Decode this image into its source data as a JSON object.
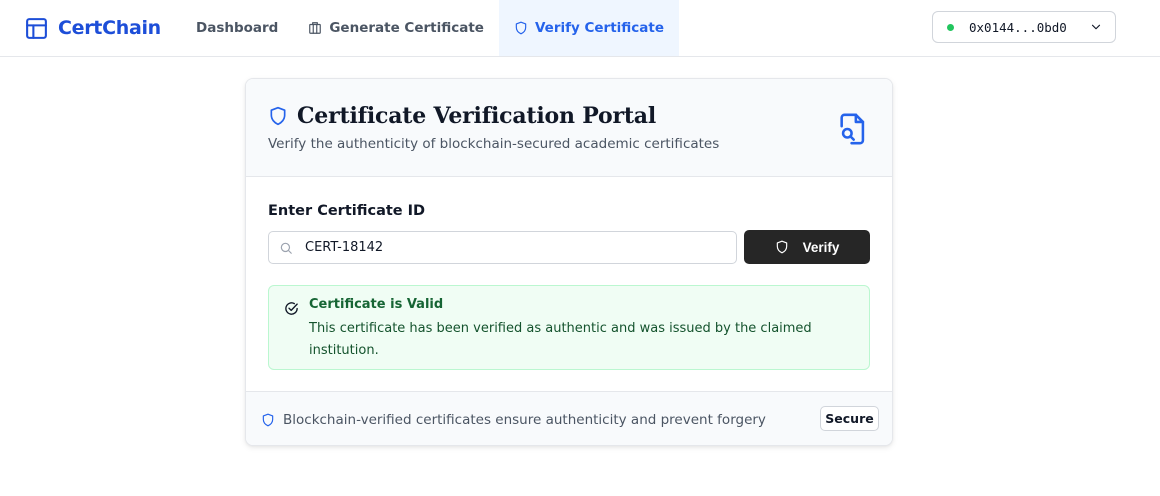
{
  "app": {
    "name": "CertChain",
    "brand_color": "#1d4ed8",
    "logo_icon": "layout-icon"
  },
  "nav": {
    "items": [
      {
        "label": "Dashboard",
        "icon": null,
        "active": false
      },
      {
        "label": "Generate Certificate",
        "icon": "building-icon",
        "active": false
      },
      {
        "label": "Verify Certificate",
        "icon": "shield-icon",
        "active": true
      }
    ],
    "active_color": "#2563eb"
  },
  "wallet": {
    "address": "0x0144...0bd0",
    "status": "connected",
    "status_color": "#22c55e"
  },
  "card": {
    "title": "Certificate Verification Portal",
    "subtitle": "Verify the authenticity of blockchain-secured academic certificates",
    "header_icon": "file-search-icon",
    "field_label": "Enter Certificate ID",
    "input_value": "CERT-18142",
    "verify_label": "Verify",
    "result": {
      "status": "valid",
      "title": "Certificate is Valid",
      "message": "This certificate has been verified as authentic and was issued by the claimed institution.",
      "color": "#166534"
    },
    "footer": {
      "text": "Blockchain-verified certificates ensure authenticity and prevent forgery",
      "badge": "Secure"
    }
  }
}
